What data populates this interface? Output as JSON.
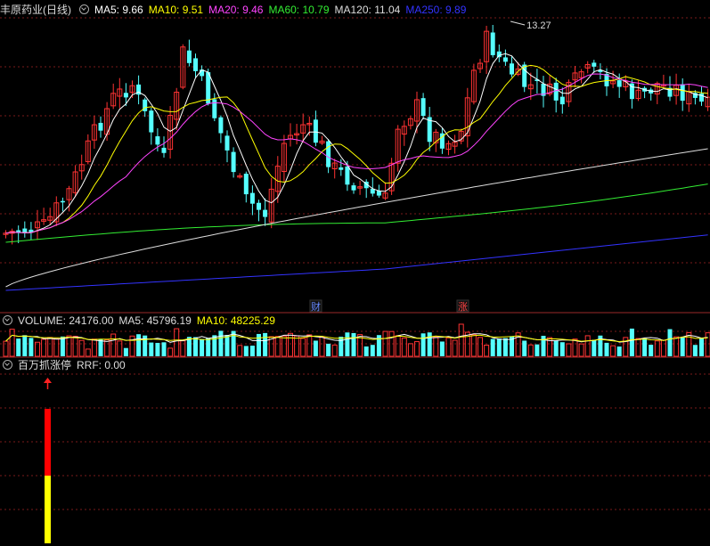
{
  "header": {
    "stock_title": "丰原药业(日线)",
    "ma_labels": [
      {
        "text": "MA5: 9.66",
        "color": "#ffffff"
      },
      {
        "text": "MA10: 9.51",
        "color": "#ffff00"
      },
      {
        "text": "MA20: 9.46",
        "color": "#ff44ff"
      },
      {
        "text": "MA60: 10.79",
        "color": "#33ee33"
      },
      {
        "text": "MA120: 11.04",
        "color": "#dddddd"
      },
      {
        "text": "MA250: 9.89",
        "color": "#3333ff"
      }
    ]
  },
  "volume_panel": {
    "labels": [
      {
        "text": "VOLUME: 24176.00",
        "color": "#dddddd"
      },
      {
        "text": "MA5: 45796.19",
        "color": "#dddddd"
      },
      {
        "text": "MA10: 48225.29",
        "color": "#ffff00"
      }
    ]
  },
  "indicator_panel": {
    "title": "百万抓涨停",
    "value_label": "RRF: 0.00",
    "signal_icon": "red-up-arrow",
    "bar_colors": {
      "top": "#ff0000",
      "bottom": "#ffff00"
    }
  },
  "price_chart": {
    "high_annotation": "13.27",
    "event_markers": [
      {
        "text": "财",
        "color": "#6688ff"
      },
      {
        "text": "涨",
        "color": "#ff4444"
      }
    ]
  },
  "colors": {
    "up": "#ff3333",
    "down": "#55ffff",
    "grid": "#7a1a1a"
  },
  "chart_data": {
    "type": "candlestick",
    "series_names": [
      "MA5",
      "MA10",
      "MA20",
      "MA60",
      "MA120",
      "MA250"
    ],
    "high_point": 13.27,
    "volume_ma": {
      "ma5": 45796.19,
      "ma10": 48225.29,
      "last_volume": 24176.0
    },
    "rrf": 0.0
  }
}
